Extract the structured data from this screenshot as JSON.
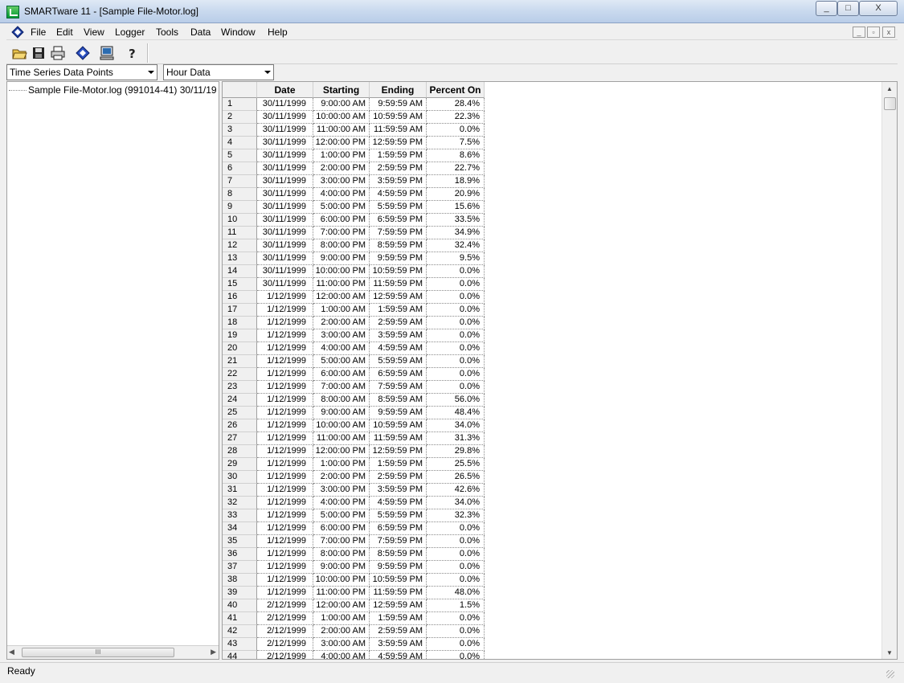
{
  "window": {
    "title": "SMARTware 11 - [Sample File-Motor.log]",
    "controls": {
      "minimize": "_",
      "maximize": "□",
      "close": "X"
    }
  },
  "menu": [
    "File",
    "Edit",
    "View",
    "Logger",
    "Tools",
    "Data",
    "Window",
    "Help"
  ],
  "mdi_controls": {
    "minimize": "_",
    "restore": "▫",
    "close": "x"
  },
  "toolbar": {
    "icons": [
      "open-folder-icon",
      "save-disk-icon",
      "print-icon",
      "logger-icon",
      "computer-icon",
      "help-icon"
    ]
  },
  "selectors": {
    "series": "Time Series Data Points",
    "interval": "Hour Data"
  },
  "tree": {
    "item": "Sample File-Motor.log  (991014-41)  30/11/19"
  },
  "grid": {
    "headers": [
      "Date",
      "Starting",
      "Ending",
      "Percent On"
    ],
    "rows": [
      [
        "1",
        "30/11/1999",
        "9:00:00 AM",
        "9:59:59 AM",
        "28.4%"
      ],
      [
        "2",
        "30/11/1999",
        "10:00:00 AM",
        "10:59:59 AM",
        "22.3%"
      ],
      [
        "3",
        "30/11/1999",
        "11:00:00 AM",
        "11:59:59 AM",
        "0.0%"
      ],
      [
        "4",
        "30/11/1999",
        "12:00:00 PM",
        "12:59:59 PM",
        "7.5%"
      ],
      [
        "5",
        "30/11/1999",
        "1:00:00 PM",
        "1:59:59 PM",
        "8.6%"
      ],
      [
        "6",
        "30/11/1999",
        "2:00:00 PM",
        "2:59:59 PM",
        "22.7%"
      ],
      [
        "7",
        "30/11/1999",
        "3:00:00 PM",
        "3:59:59 PM",
        "18.9%"
      ],
      [
        "8",
        "30/11/1999",
        "4:00:00 PM",
        "4:59:59 PM",
        "20.9%"
      ],
      [
        "9",
        "30/11/1999",
        "5:00:00 PM",
        "5:59:59 PM",
        "15.6%"
      ],
      [
        "10",
        "30/11/1999",
        "6:00:00 PM",
        "6:59:59 PM",
        "33.5%"
      ],
      [
        "11",
        "30/11/1999",
        "7:00:00 PM",
        "7:59:59 PM",
        "34.9%"
      ],
      [
        "12",
        "30/11/1999",
        "8:00:00 PM",
        "8:59:59 PM",
        "32.4%"
      ],
      [
        "13",
        "30/11/1999",
        "9:00:00 PM",
        "9:59:59 PM",
        "9.5%"
      ],
      [
        "14",
        "30/11/1999",
        "10:00:00 PM",
        "10:59:59 PM",
        "0.0%"
      ],
      [
        "15",
        "30/11/1999",
        "11:00:00 PM",
        "11:59:59 PM",
        "0.0%"
      ],
      [
        "16",
        "1/12/1999",
        "12:00:00 AM",
        "12:59:59 AM",
        "0.0%"
      ],
      [
        "17",
        "1/12/1999",
        "1:00:00 AM",
        "1:59:59 AM",
        "0.0%"
      ],
      [
        "18",
        "1/12/1999",
        "2:00:00 AM",
        "2:59:59 AM",
        "0.0%"
      ],
      [
        "19",
        "1/12/1999",
        "3:00:00 AM",
        "3:59:59 AM",
        "0.0%"
      ],
      [
        "20",
        "1/12/1999",
        "4:00:00 AM",
        "4:59:59 AM",
        "0.0%"
      ],
      [
        "21",
        "1/12/1999",
        "5:00:00 AM",
        "5:59:59 AM",
        "0.0%"
      ],
      [
        "22",
        "1/12/1999",
        "6:00:00 AM",
        "6:59:59 AM",
        "0.0%"
      ],
      [
        "23",
        "1/12/1999",
        "7:00:00 AM",
        "7:59:59 AM",
        "0.0%"
      ],
      [
        "24",
        "1/12/1999",
        "8:00:00 AM",
        "8:59:59 AM",
        "56.0%"
      ],
      [
        "25",
        "1/12/1999",
        "9:00:00 AM",
        "9:59:59 AM",
        "48.4%"
      ],
      [
        "26",
        "1/12/1999",
        "10:00:00 AM",
        "10:59:59 AM",
        "34.0%"
      ],
      [
        "27",
        "1/12/1999",
        "11:00:00 AM",
        "11:59:59 AM",
        "31.3%"
      ],
      [
        "28",
        "1/12/1999",
        "12:00:00 PM",
        "12:59:59 PM",
        "29.8%"
      ],
      [
        "29",
        "1/12/1999",
        "1:00:00 PM",
        "1:59:59 PM",
        "25.5%"
      ],
      [
        "30",
        "1/12/1999",
        "2:00:00 PM",
        "2:59:59 PM",
        "26.5%"
      ],
      [
        "31",
        "1/12/1999",
        "3:00:00 PM",
        "3:59:59 PM",
        "42.6%"
      ],
      [
        "32",
        "1/12/1999",
        "4:00:00 PM",
        "4:59:59 PM",
        "34.0%"
      ],
      [
        "33",
        "1/12/1999",
        "5:00:00 PM",
        "5:59:59 PM",
        "32.3%"
      ],
      [
        "34",
        "1/12/1999",
        "6:00:00 PM",
        "6:59:59 PM",
        "0.0%"
      ],
      [
        "35",
        "1/12/1999",
        "7:00:00 PM",
        "7:59:59 PM",
        "0.0%"
      ],
      [
        "36",
        "1/12/1999",
        "8:00:00 PM",
        "8:59:59 PM",
        "0.0%"
      ],
      [
        "37",
        "1/12/1999",
        "9:00:00 PM",
        "9:59:59 PM",
        "0.0%"
      ],
      [
        "38",
        "1/12/1999",
        "10:00:00 PM",
        "10:59:59 PM",
        "0.0%"
      ],
      [
        "39",
        "1/12/1999",
        "11:00:00 PM",
        "11:59:59 PM",
        "48.0%"
      ],
      [
        "40",
        "2/12/1999",
        "12:00:00 AM",
        "12:59:59 AM",
        "1.5%"
      ],
      [
        "41",
        "2/12/1999",
        "1:00:00 AM",
        "1:59:59 AM",
        "0.0%"
      ],
      [
        "42",
        "2/12/1999",
        "2:00:00 AM",
        "2:59:59 AM",
        "0.0%"
      ],
      [
        "43",
        "2/12/1999",
        "3:00:00 AM",
        "3:59:59 AM",
        "0.0%"
      ],
      [
        "44",
        "2/12/1999",
        "4:00:00 AM",
        "4:59:59 AM",
        "0.0%"
      ]
    ]
  },
  "scrollbar": {
    "hthumb": "III"
  },
  "status": "Ready"
}
